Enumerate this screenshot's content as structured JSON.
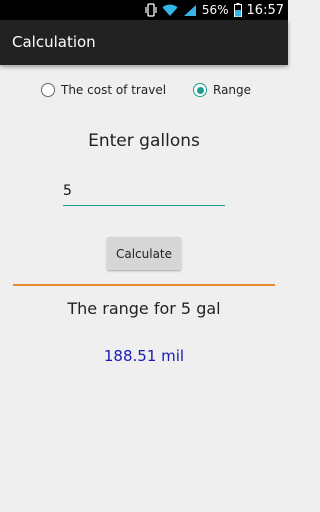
{
  "status_bar": {
    "battery": "56%",
    "time": "16:57",
    "icons": [
      "vibrate-icon",
      "wifi-icon",
      "signal-icon",
      "battery-icon"
    ]
  },
  "app": {
    "title": "Calculation"
  },
  "mode": {
    "options": [
      {
        "label": "The cost of travel",
        "selected": false
      },
      {
        "label": "Range",
        "selected": true
      }
    ]
  },
  "form": {
    "prompt": "Enter gallons",
    "gallons_value": "5",
    "calculate_label": "Calculate"
  },
  "result": {
    "label": "The range for 5 gal",
    "value": "188.51 mil"
  },
  "colors": {
    "accent": "#1a9c8c",
    "divider": "#e38b2c",
    "result_value": "#1a1ab4"
  }
}
